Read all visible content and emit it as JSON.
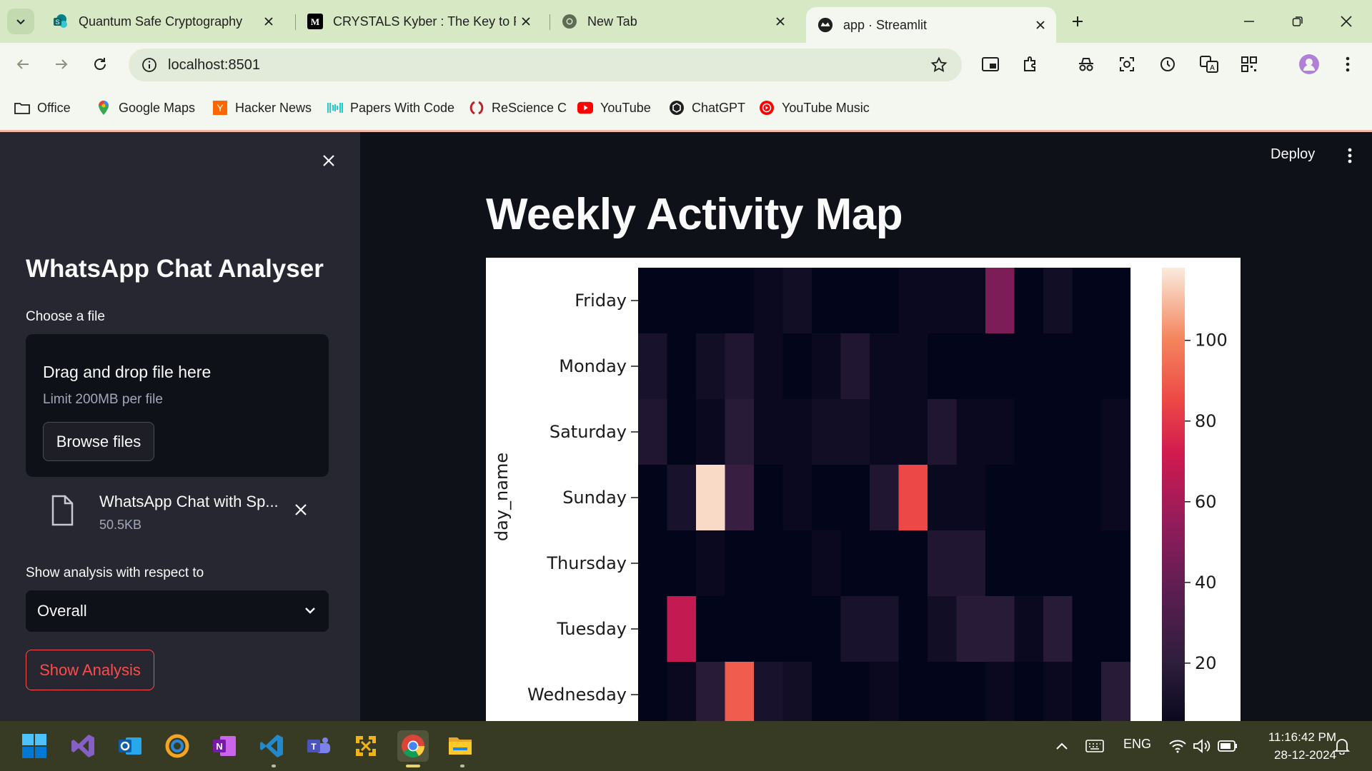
{
  "browser": {
    "tabs": [
      {
        "title": "Quantum Safe Cryptography",
        "icon": "sharepoint-icon",
        "active": false
      },
      {
        "title": "CRYSTALS Kyber : The Key to Po",
        "icon": "medium-icon",
        "active": false
      },
      {
        "title": "New Tab",
        "icon": "chrome-icon",
        "active": false
      },
      {
        "title": "app · Streamlit",
        "icon": "streamlit-icon",
        "active": true
      }
    ],
    "url": "localhost:8501",
    "bookmarks": [
      {
        "label": "Office",
        "icon": "folder-icon"
      },
      {
        "label": "Google Maps",
        "icon": "maps-pin-icon"
      },
      {
        "label": "Hacker News",
        "icon": "hacker-news-icon"
      },
      {
        "label": "Papers With Code",
        "icon": "papers-icon"
      },
      {
        "label": "ReScience C",
        "icon": "rescience-icon"
      },
      {
        "label": "YouTube",
        "icon": "youtube-icon"
      },
      {
        "label": "ChatGPT",
        "icon": "chatgpt-icon"
      },
      {
        "label": "YouTube Music",
        "icon": "youtube-music-icon"
      }
    ],
    "accent": "#d6e8c4"
  },
  "sidebar": {
    "title": "WhatsApp Chat Analyser",
    "file_label": "Choose a file",
    "dropzone_title": "Drag and drop file here",
    "dropzone_limit": "Limit 200MB per file",
    "browse_label": "Browse files",
    "file_name": "WhatsApp Chat with Sp...",
    "file_size": "50.5KB",
    "select_label": "Show analysis with respect to",
    "select_value": "Overall",
    "button_label": "Show Analysis"
  },
  "header": {
    "deploy": "Deploy"
  },
  "main": {
    "title": "Weekly Activity Map"
  },
  "chart_data": {
    "type": "heatmap",
    "ylabel": "day_name",
    "y_categories": [
      "Friday",
      "Monday",
      "Saturday",
      "Sunday",
      "Thursday",
      "Tuesday",
      "Wednesday"
    ],
    "columns": 17,
    "values": [
      [
        3,
        3,
        3,
        3,
        6,
        9,
        3,
        3,
        3,
        6,
        6,
        6,
        48,
        3,
        9,
        3,
        3
      ],
      [
        12,
        3,
        9,
        15,
        6,
        3,
        6,
        15,
        6,
        6,
        3,
        3,
        3,
        3,
        3,
        3,
        3
      ],
      [
        15,
        3,
        6,
        18,
        6,
        6,
        9,
        9,
        6,
        6,
        15,
        6,
        6,
        3,
        3,
        3,
        6
      ],
      [
        3,
        12,
        115,
        24,
        3,
        6,
        3,
        3,
        15,
        85,
        6,
        6,
        3,
        3,
        3,
        3,
        6
      ],
      [
        3,
        3,
        6,
        3,
        3,
        3,
        6,
        3,
        3,
        3,
        15,
        15,
        3,
        3,
        3,
        3,
        3
      ],
      [
        3,
        68,
        3,
        3,
        3,
        3,
        3,
        12,
        12,
        3,
        9,
        18,
        18,
        6,
        18,
        3,
        3
      ],
      [
        3,
        6,
        18,
        90,
        12,
        9,
        3,
        3,
        6,
        3,
        3,
        3,
        6,
        3,
        6,
        3,
        18
      ]
    ],
    "colorbar_ticks": [
      20,
      40,
      60,
      80,
      100
    ],
    "vmin": 3,
    "vmax": 118,
    "colormap": "rocket",
    "grid": false
  },
  "taskbar": {
    "apps": [
      "windows-start-icon",
      "visual-studio-icon",
      "outlook-icon",
      "snipping-icon",
      "onenote-icon",
      "vscode-icon",
      "teams-icon",
      "jupyter-icon",
      "chrome-icon",
      "file-explorer-icon"
    ],
    "language": "ENG",
    "time": "11:16:42 PM",
    "date": "28-12-2024"
  }
}
